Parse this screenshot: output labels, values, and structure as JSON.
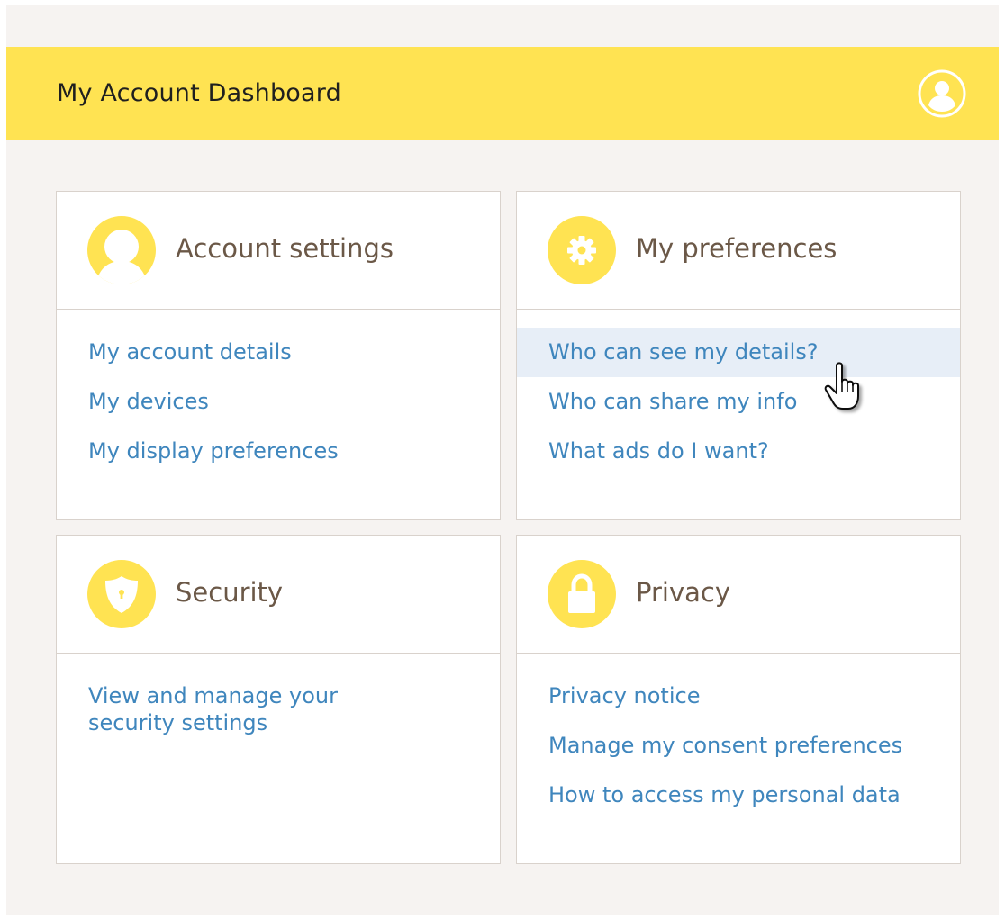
{
  "header": {
    "title": "My Account Dashboard",
    "profile_icon": "user-circle-icon"
  },
  "colors": {
    "accent": "#ffe352",
    "link": "#3f86bd",
    "card_title": "#6b5847",
    "background": "#f6f3f1",
    "hover_row": "#e7eef7"
  },
  "cards": [
    {
      "title": "Account settings",
      "icon": "person-icon",
      "links": [
        "My account details",
        "My devices",
        "My display preferences"
      ]
    },
    {
      "title": "My preferences",
      "icon": "gear-icon",
      "links": [
        "Who can see my details?",
        "Who can share my info",
        "What ads do I want?"
      ],
      "hovered_link": "Who can see my details?"
    },
    {
      "title": "Security",
      "icon": "shield-icon",
      "links": [
        "View and manage your security settings"
      ]
    },
    {
      "title": "Privacy",
      "icon": "lock-icon",
      "links": [
        "Privacy notice",
        "Manage my consent preferences",
        "How to access my personal data"
      ]
    }
  ],
  "cursor": "hand-pointer-icon"
}
